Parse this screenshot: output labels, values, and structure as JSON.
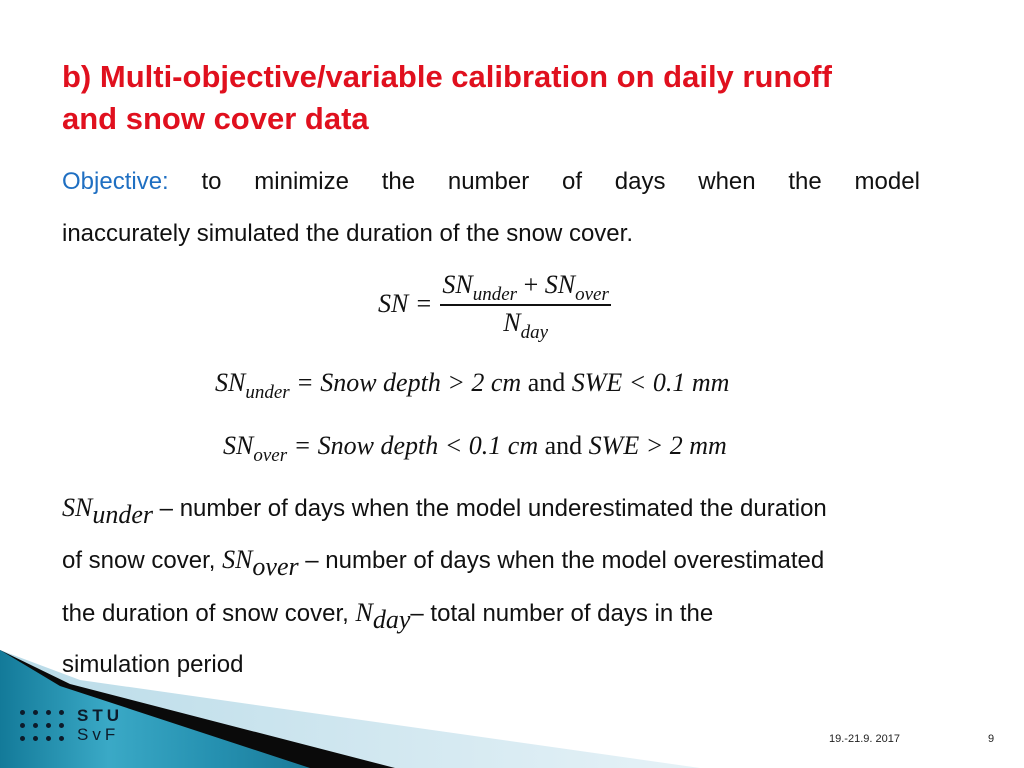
{
  "title": {
    "line1": "b) Multi-objective/variable calibration on daily runoff",
    "line2": "and snow cover data"
  },
  "objective": {
    "label": "Objective:",
    "words": [
      "to",
      "minimize",
      "the",
      "number",
      "of",
      "days",
      "when",
      "the",
      "model"
    ],
    "line2": "inaccurately simulated the duration of the snow cover."
  },
  "formula_main": {
    "lhs": "SN =",
    "num_a": "SN",
    "num_a_sub": "under",
    "plus": "+",
    "num_b": "SN",
    "num_b_sub": "over",
    "den": "N",
    "den_sub": "day"
  },
  "formula_under": {
    "lhs": "SN",
    "lhs_sub": "under",
    "rhs_a": "= Snow depth  > 2 cm",
    "and": "and",
    "rhs_b": "SWE  < 0.1 mm"
  },
  "formula_over": {
    "lhs": "SN",
    "lhs_sub": "over",
    "rhs_a": "= Snow depth  < 0.1 cm",
    "and": "and",
    "rhs_b": "SWE  > 2 mm"
  },
  "definitions": {
    "d1_sym": "SN",
    "d1_sub": "under",
    "d1_text": " – number of days when the model underestimated the duration",
    "d2_text_a": "of snow cover, ",
    "d2_sym": "SN",
    "d2_sub": "over",
    "d2_text_b": " – number of days when the model overestimated",
    "d3_text_a": "the duration of snow cover, ",
    "d3_sym": "N",
    "d3_sub": "day",
    "d3_text_b": "– total number of days in the",
    "d4_text": "simulation period"
  },
  "footer": {
    "date": "19.-21.9. 2017",
    "page": "9"
  },
  "logo": {
    "line1": "STU",
    "line2": "SvF"
  },
  "colors": {
    "title": "#e0101e",
    "objective_label": "#1f6fc2",
    "deco_teal": "#1f8fae"
  }
}
